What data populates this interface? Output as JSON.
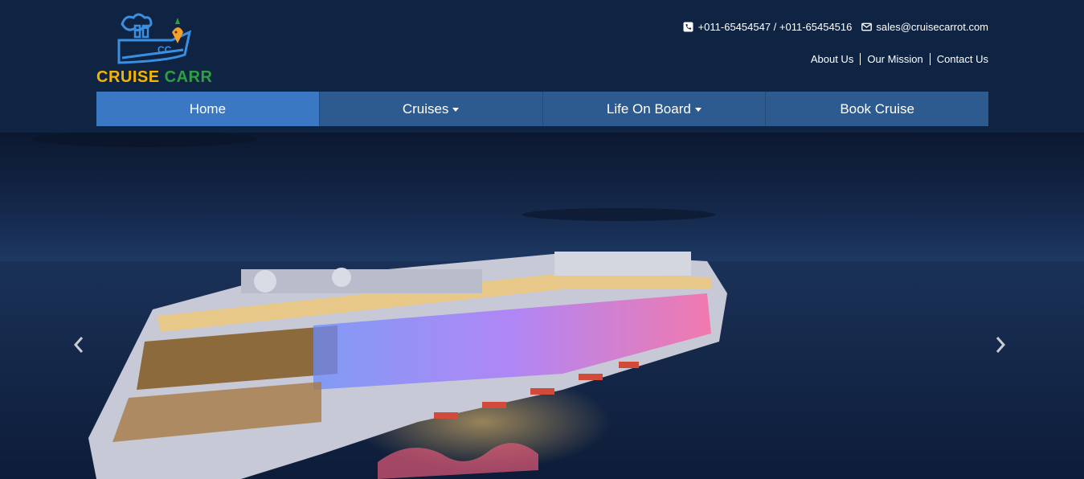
{
  "brand": {
    "logo_icon": "cruise-ship-logo",
    "logo_text": "CRUISE CARROT",
    "logo_colors": [
      "#3b8fe0",
      "#f4b400",
      "#2ea043",
      "#e8701a"
    ]
  },
  "contact": {
    "phone_icon": "phone-icon",
    "phone_text": "+011-65454547 / +011-65454516",
    "email_icon": "envelope-icon",
    "email_text": "sales@cruisecarrot.com"
  },
  "top_links": [
    {
      "label": "About Us"
    },
    {
      "label": "Our Mission"
    },
    {
      "label": "Contact Us"
    }
  ],
  "nav": {
    "items": [
      {
        "label": "Home",
        "active": true,
        "dropdown": false
      },
      {
        "label": "Cruises",
        "active": false,
        "dropdown": true
      },
      {
        "label": "Life On Board",
        "active": false,
        "dropdown": true
      },
      {
        "label": "Book Cruise",
        "active": false,
        "dropdown": false
      }
    ]
  },
  "hero": {
    "image": "cruise-ship-at-night",
    "prev_icon": "chevron-left-icon",
    "next_icon": "chevron-right-icon"
  },
  "colors": {
    "header_bg": "#0f2442",
    "nav_bg": "#2d5b8f",
    "nav_active": "#3b78c4",
    "text": "#ffffff"
  }
}
